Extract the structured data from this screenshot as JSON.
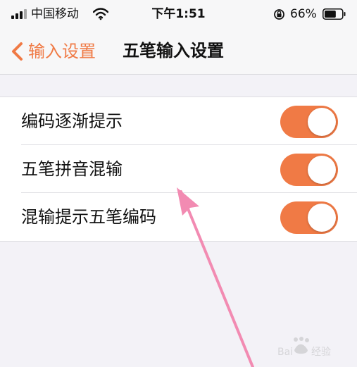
{
  "status_bar": {
    "carrier": "中国移动",
    "time": "下午1:51",
    "battery_percent": "66%",
    "battery_level": 0.66
  },
  "nav": {
    "back_label": "输入设置",
    "title": "五笔输入设置"
  },
  "settings": [
    {
      "label": "编码逐渐提示",
      "enabled": true
    },
    {
      "label": "五笔拼音混输",
      "enabled": true
    },
    {
      "label": "混输提示五笔编码",
      "enabled": true
    }
  ],
  "colors": {
    "accent": "#f07a45",
    "arrow": "#f28bb2",
    "background": "#f3f2f7"
  },
  "icons": {
    "back": "chevron-left-icon",
    "signal": "signal-icon",
    "wifi": "wifi-icon",
    "lock": "orientation-lock-icon",
    "battery": "battery-icon"
  }
}
